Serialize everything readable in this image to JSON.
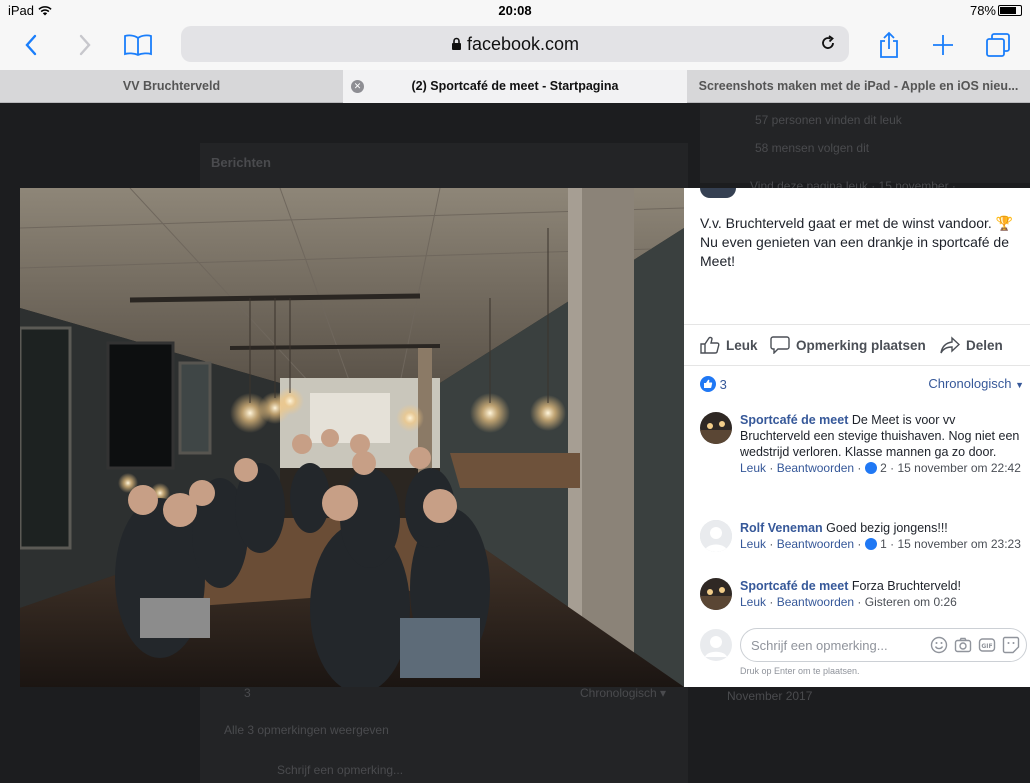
{
  "status": {
    "device": "iPad",
    "time": "20:08",
    "battery": "78%"
  },
  "browser": {
    "url": "facebook.com"
  },
  "tabs": [
    {
      "label": "VV Bruchterveld"
    },
    {
      "label": "(2) Sportcafé de meet - Startpagina"
    },
    {
      "label": "Screenshots maken met de iPad - Apple en iOS nieu..."
    }
  ],
  "background": {
    "likes_text": "57 personen vinden dit leuk",
    "follows_text": "58 mensen volgen dit",
    "section": "Berichten",
    "page_like_text": "Vind deze pagina leuk · 15 november ·",
    "likes_count": "3",
    "sort": "Chronologisch ▾",
    "view_all": "Alle 3 opmerkingen weergeven",
    "compose": "Schrijf een opmerking...",
    "date": "November 2017"
  },
  "post": {
    "text": "V.v. Bruchterveld gaat er met de winst vandoor. 🏆 Nu even genieten van een drankje in sportcafé de Meet!",
    "actions": {
      "like": "Leuk",
      "comment": "Opmerking plaatsen",
      "share": "Delen"
    },
    "like_count": "3",
    "sort_label": "Chronologisch"
  },
  "comments": [
    {
      "author": "Sportcafé de meet",
      "text": "De Meet is voor vv Bruchterveld een stevige thuishaven. Nog niet een wedstrijd verloren. Klasse mannen ga zo door.",
      "like": "Leuk",
      "reply": "Beantwoorden",
      "count": "2",
      "time": "15 november om 22:42"
    },
    {
      "author": "Rolf Veneman",
      "text": "Goed bezig jongens!!!",
      "like": "Leuk",
      "reply": "Beantwoorden",
      "count": "1",
      "time": "15 november om 23:23"
    },
    {
      "author": "Sportcafé de meet",
      "text": "Forza Bruchterveld!",
      "like": "Leuk",
      "reply": "Beantwoorden",
      "count": "",
      "time": "Gisteren om 0:26"
    }
  ],
  "compose": {
    "placeholder": "Schrijf een opmerking...",
    "hint": "Druk op Enter om te plaatsen."
  },
  "colors": {
    "link": "#365899",
    "accent": "#1a7efb",
    "like": "#2078f4"
  }
}
